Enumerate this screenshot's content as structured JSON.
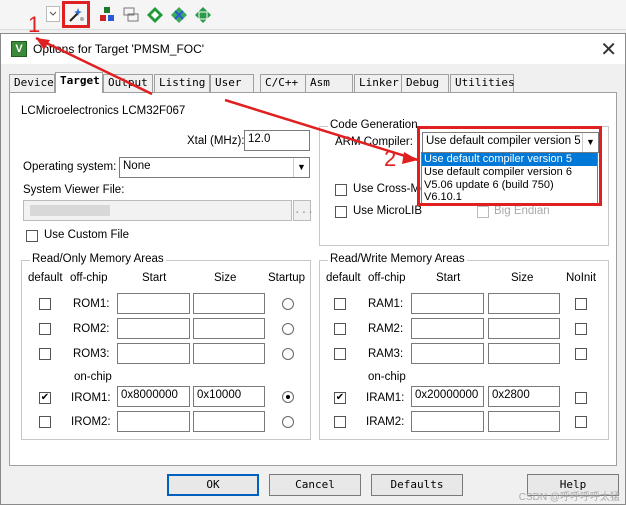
{
  "toolbar": {
    "icons": [
      "chevron-down-icon",
      "magic-wand-icon",
      "stack-icon",
      "windows-icon",
      "green-diamond-icon",
      "diamond-cross-icon",
      "diamond-grid-icon"
    ]
  },
  "dialog": {
    "title": "Options for Target 'PMSM_FOC'",
    "close": "✕",
    "tabs": [
      "Device",
      "Target",
      "Output",
      "Listing",
      "User",
      "C/C++",
      "Asm",
      "Linker",
      "Debug",
      "Utilities"
    ],
    "active_tab": "Target",
    "device_name": "LCMicroelectronics LCM32F067",
    "xtal_label": "Xtal (MHz):",
    "xtal_value": "12.0",
    "os_label": "Operating system:",
    "os_value": "None",
    "svf_label": "System Viewer File:",
    "svf_browse": "...",
    "use_custom_file": "Use Custom File",
    "code_generation": {
      "title": "Code Generation",
      "arm_compiler_label": "ARM Compiler:",
      "arm_compiler_value": "Use default compiler version 5",
      "options": [
        "Use default compiler version 5",
        "Use default compiler version 6",
        "V5.06 update 6 (build 750)",
        "V6.10.1"
      ],
      "use_cross_module": "Use Cross-Mod",
      "use_microlib": "Use MicroLIB",
      "big_endian": "Big Endian"
    },
    "ro_memory": {
      "title": "Read/Only Memory Areas",
      "headers": [
        "default",
        "off-chip",
        "Start",
        "Size",
        "Startup"
      ],
      "rows": [
        {
          "name": "ROM1:",
          "start": "",
          "size": "",
          "default": false,
          "selected": false
        },
        {
          "name": "ROM2:",
          "start": "",
          "size": "",
          "default": false,
          "selected": false
        },
        {
          "name": "ROM3:",
          "start": "",
          "size": "",
          "default": false,
          "selected": false
        },
        {
          "name": "IROM1:",
          "start": "0x8000000",
          "size": "0x10000",
          "default": true,
          "selected": true
        },
        {
          "name": "IROM2:",
          "start": "",
          "size": "",
          "default": false,
          "selected": false
        }
      ],
      "on_chip": "on-chip"
    },
    "rw_memory": {
      "title": "Read/Write Memory Areas",
      "headers": [
        "default",
        "off-chip",
        "Start",
        "Size",
        "NoInit"
      ],
      "rows": [
        {
          "name": "RAM1:",
          "start": "",
          "size": "",
          "default": false
        },
        {
          "name": "RAM2:",
          "start": "",
          "size": "",
          "default": false
        },
        {
          "name": "RAM3:",
          "start": "",
          "size": "",
          "default": false
        },
        {
          "name": "IRAM1:",
          "start": "0x20000000",
          "size": "0x2800",
          "default": true
        },
        {
          "name": "IRAM2:",
          "start": "",
          "size": "",
          "default": false
        }
      ],
      "on_chip": "on-chip"
    },
    "buttons": {
      "ok": "OK",
      "cancel": "Cancel",
      "defaults": "Defaults",
      "help": "Help"
    }
  },
  "annotations": {
    "num1": "1",
    "num2": "2",
    "color": "#e02020"
  },
  "watermark": "CSDN @呼呼呼呼太猛"
}
